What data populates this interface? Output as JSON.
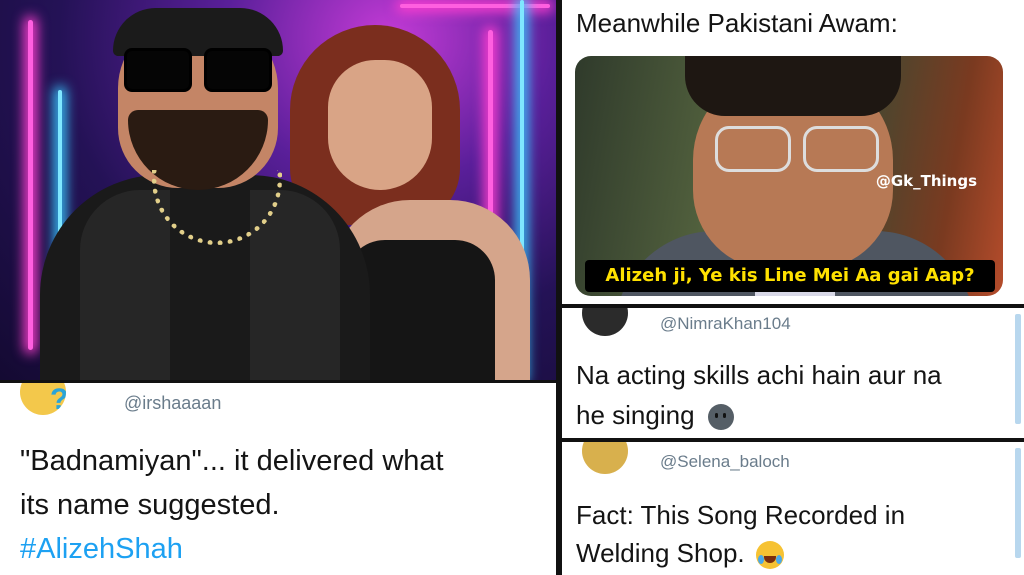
{
  "tweet_top_right": {
    "text": "Meanwhile Pakistani Awam:",
    "meme_caption": "Alizeh ji, Ye kis Line Mei Aa gai Aap?",
    "meme_watermark": "@Gk_Things"
  },
  "tweet_irsha": {
    "handle": "@irshaaaan",
    "line1": "\"Badnamiyan\"... it delivered what",
    "line2": "its name suggested.",
    "hashtag": "#AlizehShah"
  },
  "tweet_nimra": {
    "handle": "@NimraKhan104",
    "line1": "Na acting skills achi hain aur na",
    "line2": "he singing",
    "emoji": "neutral-face"
  },
  "tweet_selena": {
    "handle": "@Selena_baloch",
    "line1": "Fact: This Song Recorded in",
    "line2": "Welding Shop.",
    "emoji": "face-with-tears-of-joy"
  },
  "colors": {
    "hashtag": "#1da1f2",
    "handle": "#6a7c8b",
    "caption_text": "#ffe100"
  }
}
